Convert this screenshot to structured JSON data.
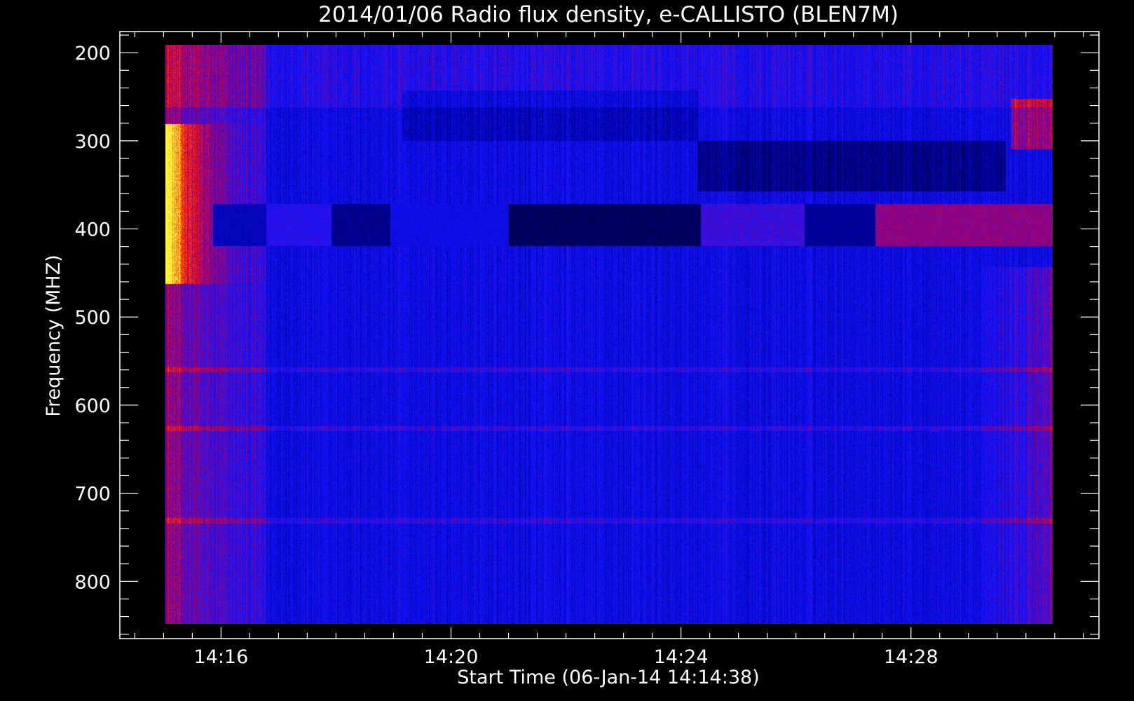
{
  "chart_data": {
    "type": "heatmap",
    "title": "2014/01/06  Radio flux density, e-CALLISTO (BLEN7M)",
    "xlabel": "Start Time (06-Jan-14 14:14:38)",
    "ylabel": "Frequency (MHZ)",
    "x_ticks": [
      "14:16",
      "14:20",
      "14:24",
      "14:28"
    ],
    "x_tick_minutes": [
      16,
      20,
      24,
      28
    ],
    "y_ticks": [
      "200",
      "300",
      "400",
      "500",
      "600",
      "700",
      "800"
    ],
    "y_tick_values": [
      200,
      300,
      400,
      500,
      600,
      700,
      800
    ],
    "xlim_minutes": [
      14.24,
      31.27
    ],
    "data_xlim_minutes": [
      15.0,
      30.0
    ],
    "ylim_mhz": [
      865,
      176
    ],
    "data_ylim_mhz": [
      176,
      865
    ],
    "y_inverted": true,
    "colormap": "blue-red-yellow",
    "colors": {
      "background": "#000000",
      "axes": "#ffffff",
      "low": "#000010",
      "mid": "#2222ff",
      "high": "#ffee40"
    },
    "features": [
      {
        "kind": "burst",
        "minutes": [
          15.0,
          15.6
        ],
        "mhz": [
          270,
          450
        ],
        "level": "high"
      },
      {
        "kind": "burst",
        "minutes": [
          15.0,
          16.7
        ],
        "mhz": [
          270,
          865
        ],
        "level": "elevated"
      },
      {
        "kind": "burst",
        "minutes": [
          29.4,
          30.0
        ],
        "mhz": [
          460,
          760
        ],
        "level": "elevated"
      },
      {
        "kind": "band",
        "minutes": [
          15.8,
          30.0
        ],
        "mhz": [
          365,
          415
        ],
        "note": "alternating segments 14:15:48 to 14:30"
      },
      {
        "kind": "dark_region",
        "minutes": [
          24.0,
          29.2
        ],
        "mhz": [
          290,
          350
        ]
      },
      {
        "kind": "line",
        "minutes": [
          15.0,
          30.0
        ],
        "mhz": [
          562,
          562
        ]
      },
      {
        "kind": "line",
        "minutes": [
          15.0,
          30.0
        ],
        "mhz": [
          632,
          632
        ]
      },
      {
        "kind": "line",
        "minutes": [
          15.0,
          30.0
        ],
        "mhz": [
          742,
          742
        ]
      }
    ]
  }
}
